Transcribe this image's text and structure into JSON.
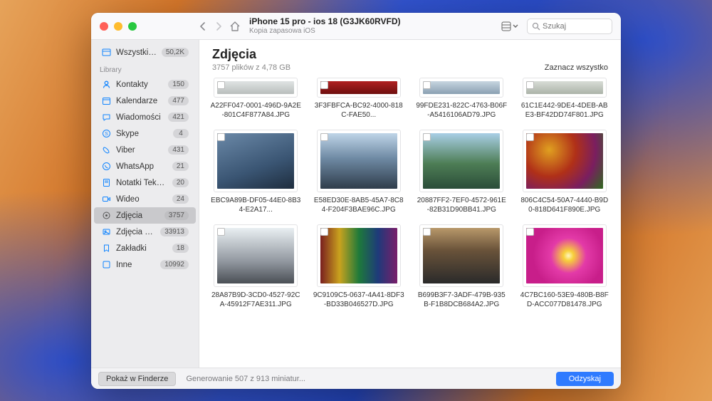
{
  "titlebar": {
    "title": "iPhone 15 pro - ios 18 (G3JK60RVFD)",
    "subtitle": "Kopia zapasowa iOS",
    "search_placeholder": "Szukaj"
  },
  "sidebar": {
    "top": {
      "label": "Wszystkie pliki",
      "badge": "50,2K"
    },
    "section_label": "Library",
    "items": [
      {
        "icon": "contacts",
        "label": "Kontakty",
        "badge": "150"
      },
      {
        "icon": "calendar",
        "label": "Kalendarze",
        "badge": "477"
      },
      {
        "icon": "chat",
        "label": "Wiadomości",
        "badge": "421"
      },
      {
        "icon": "skype",
        "label": "Skype",
        "badge": "4"
      },
      {
        "icon": "viber",
        "label": "Viber",
        "badge": "431"
      },
      {
        "icon": "whatsapp",
        "label": "WhatsApp",
        "badge": "21"
      },
      {
        "icon": "notes",
        "label": "Notatki Tekstowe",
        "badge": "20"
      },
      {
        "icon": "video",
        "label": "Wideo",
        "badge": "24"
      },
      {
        "icon": "photos",
        "label": "Zdjęcia",
        "badge": "3757",
        "selected": true
      },
      {
        "icon": "appphotos",
        "label": "Zdjęcia aplikacji",
        "badge": "33913"
      },
      {
        "icon": "bookmarks",
        "label": "Zakładki",
        "badge": "18"
      },
      {
        "icon": "other",
        "label": "Inne",
        "badge": "10992"
      }
    ]
  },
  "main": {
    "heading": "Zdjęcia",
    "subheading": "3757 plików z 4,78 GB",
    "select_all": "Zaznacz wszystko"
  },
  "thumbs": [
    {
      "cls": "p-a",
      "name": "A22FF047-0001-496D-9A2E-801C4F877A84.JPG"
    },
    {
      "cls": "p-b",
      "name": "3F3FBFCA-BC92-4000-818C-FAE50..."
    },
    {
      "cls": "p-c",
      "name": "99FDE231-822C-4763-B06F-A5416106AD79.JPG"
    },
    {
      "cls": "p-d",
      "name": "61C1E442-9DE4-4DEB-ABE3-BF42DD74F801.JPG"
    },
    {
      "cls": "p-e",
      "name": "EBC9A89B-DF05-44E0-8B34-E2A17..."
    },
    {
      "cls": "p-f",
      "name": "E58ED30E-8AB5-45A7-8C84-F204F3BAE96C.JPG"
    },
    {
      "cls": "p-g",
      "name": "20887FF2-7EF0-4572-961E-82B31D90BB41.JPG"
    },
    {
      "cls": "p-h",
      "name": "806C4C54-50A7-4440-B9D0-818D641F890E.JPG"
    },
    {
      "cls": "p-i",
      "name": "28A87B9D-3CD0-4527-92CA-45912F7AE311.JPG"
    },
    {
      "cls": "p-j",
      "name": "9C9109C5-0637-4A41-8DF3-BD33B046527D.JPG"
    },
    {
      "cls": "p-k",
      "name": "B699B3F7-3ADF-479B-935B-F1B8DCB684A2.JPG"
    },
    {
      "cls": "p-l",
      "name": "4C7BC160-53E9-480B-B8FD-ACC077D81478.JPG"
    }
  ],
  "footer": {
    "show_in_finder": "Pokaż w Finderze",
    "status": "Generowanie 507 z 913 miniatur...",
    "recover": "Odzyskaj"
  }
}
